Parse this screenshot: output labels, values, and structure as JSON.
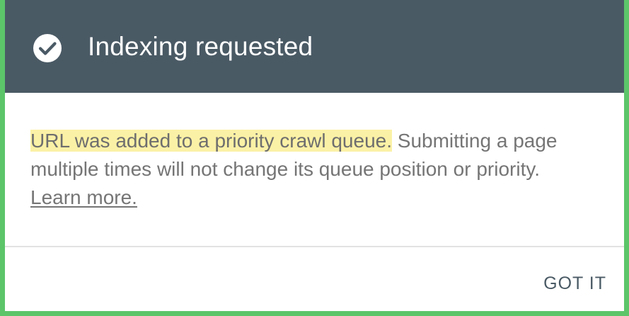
{
  "dialog": {
    "title": "Indexing requested",
    "icon": "check-circle-icon",
    "message_highlighted": "URL was added to a priority crawl queue.",
    "message_rest": " Submitting a page multiple times will not change its queue position or priority.",
    "learn_more_label": "Learn more.",
    "action_label": "GOT IT",
    "colors": {
      "header_bg": "#4a5a65",
      "highlight": "#fbf1a6",
      "frame": "#5cc56a",
      "action_text": "#4a5a65"
    }
  }
}
